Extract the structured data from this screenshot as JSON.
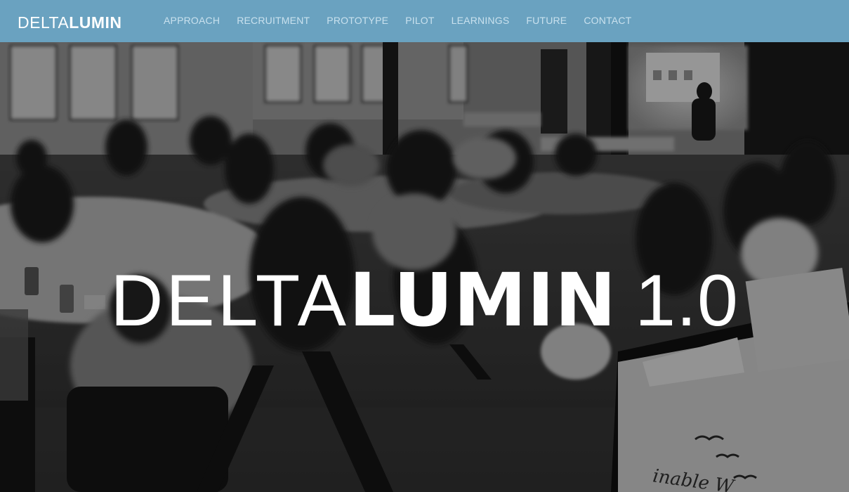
{
  "brand": {
    "light": "DELTA",
    "bold": "LUMIN"
  },
  "nav": {
    "items": [
      {
        "label": "APPROACH"
      },
      {
        "label": "RECRUITMENT"
      },
      {
        "label": "PROTOTYPE"
      },
      {
        "label": "PILOT"
      },
      {
        "label": "LEARNINGS"
      },
      {
        "label": "FUTURE"
      },
      {
        "label": "CONTACT"
      }
    ]
  },
  "hero": {
    "title_light": "DELTA",
    "title_bold": "LUMIN",
    "version": "1.0",
    "background_text": "inable W",
    "background_description": "grayscale photo of a community meeting with people seated at round tables"
  },
  "colors": {
    "navbar": "#6aa2c0",
    "nav_link": "#c9e1ee",
    "brand": "#ffffff",
    "hero_text": "#ffffff"
  }
}
